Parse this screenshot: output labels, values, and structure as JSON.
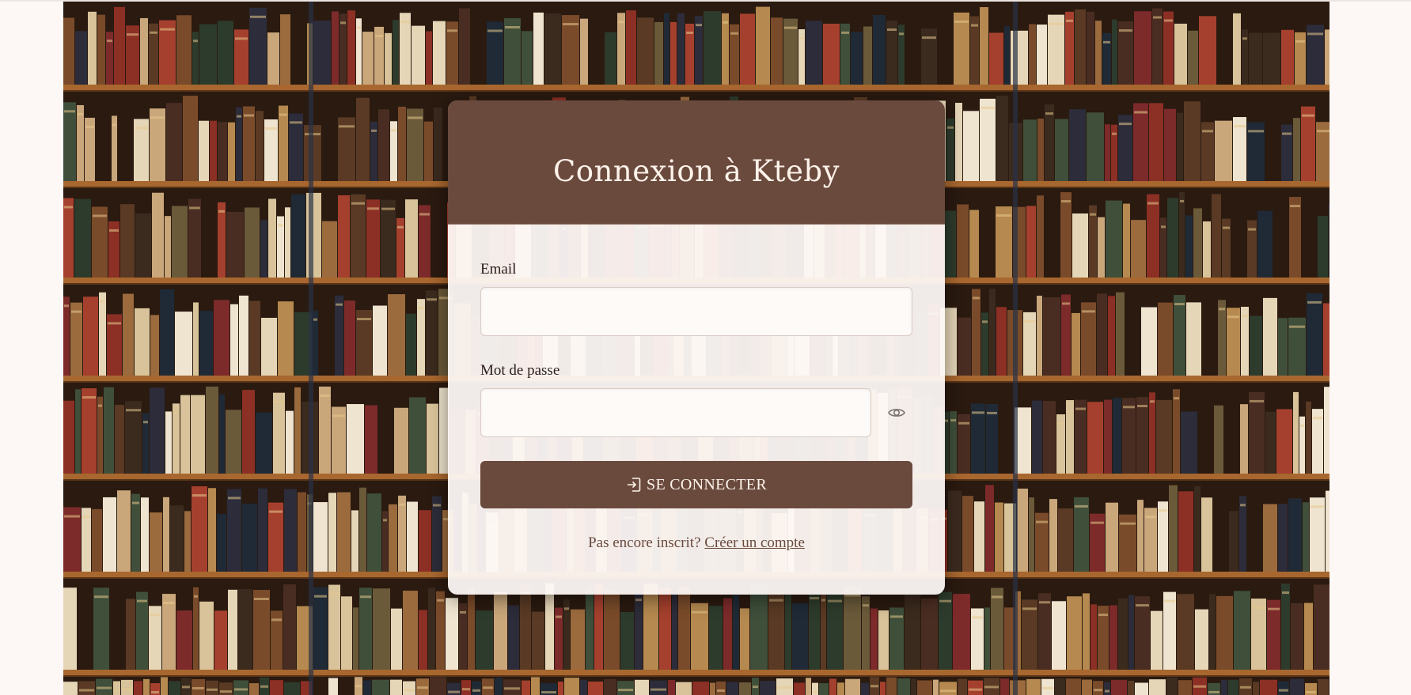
{
  "login": {
    "title": "Connexion à Kteby",
    "email_label": "Email",
    "email_value": "",
    "password_label": "Mot de passe",
    "password_value": "",
    "submit_label": "SE CONNECTER",
    "signup_prompt": "Pas encore inscrit?",
    "signup_link": "Créer un compte"
  },
  "icons": {
    "password_toggle": "eye-icon",
    "submit": "login-icon"
  },
  "colors": {
    "primary": "#6b4a3e",
    "header_text": "#fdf3ea",
    "page_background": "#fdf8f5"
  }
}
